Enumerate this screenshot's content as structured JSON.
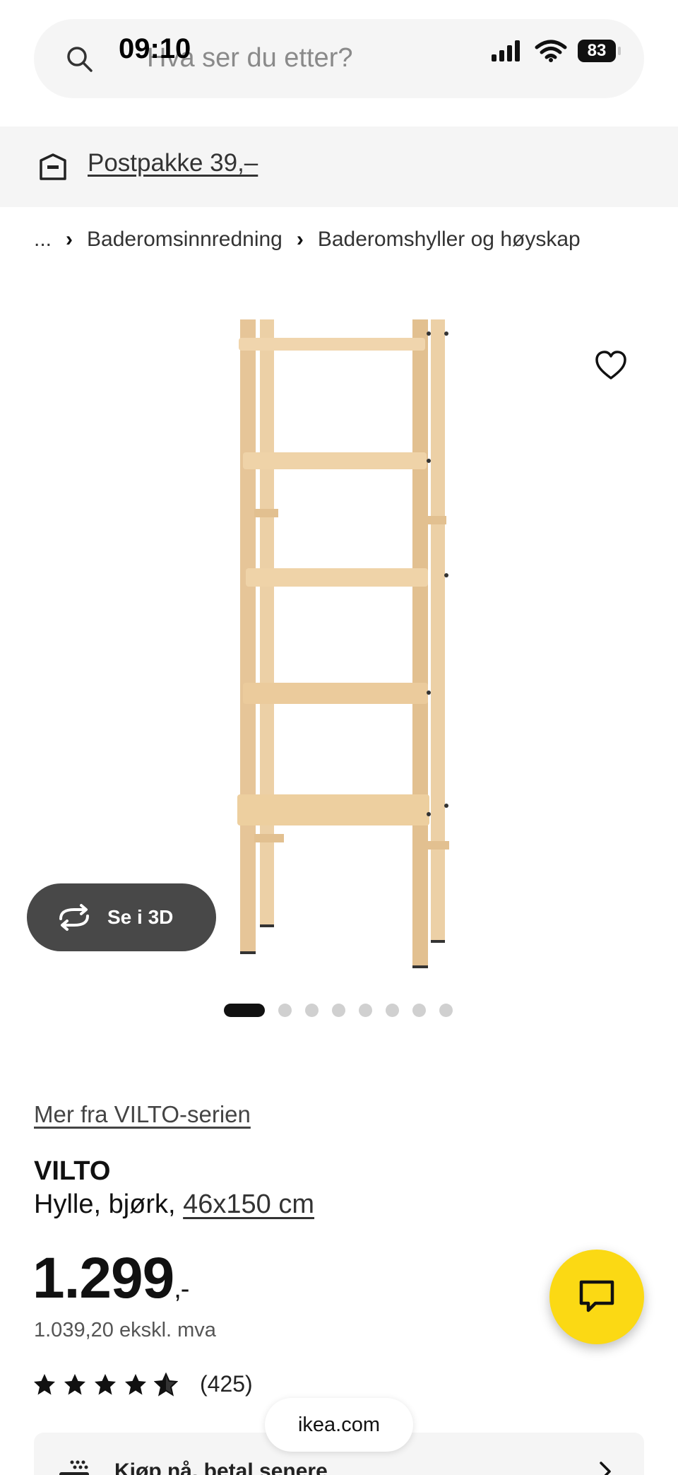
{
  "status_bar": {
    "time": "09:10",
    "battery": "83"
  },
  "search": {
    "placeholder": "Hva ser du etter?"
  },
  "banner": {
    "text": "Postpakke 39,–"
  },
  "breadcrumb": {
    "items": [
      "...",
      "Baderomsinnredning",
      "Baderomshyller og høyskap"
    ]
  },
  "gallery": {
    "view_3d_label": "Se i 3D",
    "image_count": 8,
    "active_index": 0
  },
  "product": {
    "series_link": "Mer fra VILTO-serien",
    "name": "VILTO",
    "description": "Hylle, bjørk,",
    "size": "46x150 cm",
    "price": "1.299",
    "price_suffix": ",-",
    "price_ex_vat": "1.039,20 ekskl. mva",
    "rating_stars": 4.5,
    "rating_count": "(425)"
  },
  "bottom": {
    "klarna_text": "Kjøp nå, betal senere",
    "url": "ikea.com"
  },
  "colors": {
    "accent_yellow": "#fbd914",
    "button_dark": "#484848",
    "banner_bg": "#f5f5f5"
  }
}
